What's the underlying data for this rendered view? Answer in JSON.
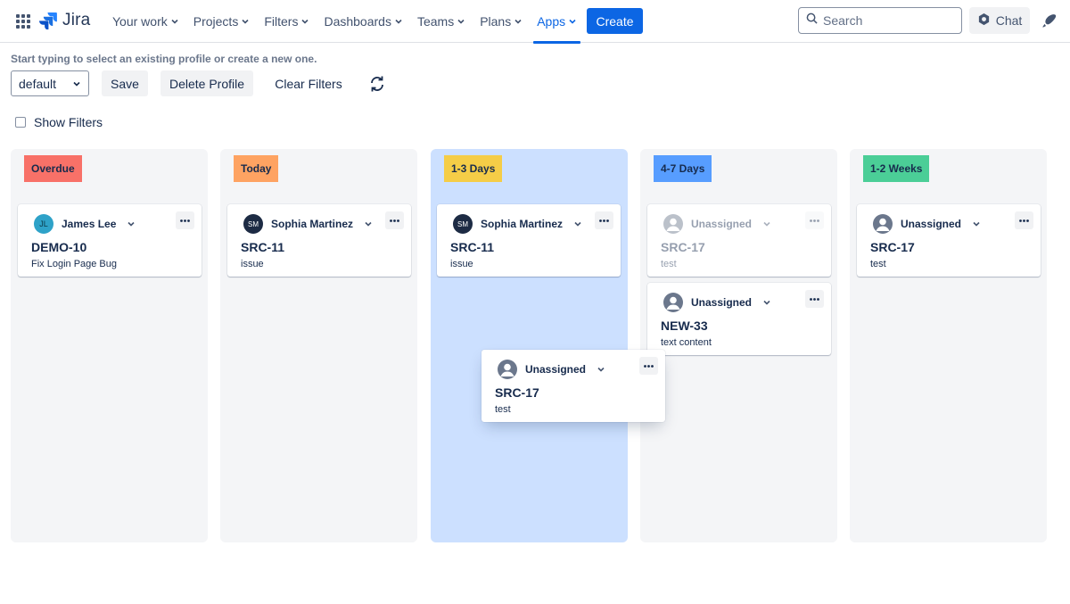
{
  "nav": {
    "app_name": "Jira",
    "items": [
      {
        "label": "Your work",
        "active": false
      },
      {
        "label": "Projects",
        "active": false
      },
      {
        "label": "Filters",
        "active": false
      },
      {
        "label": "Dashboards",
        "active": false
      },
      {
        "label": "Teams",
        "active": false
      },
      {
        "label": "Plans",
        "active": false
      },
      {
        "label": "Apps",
        "active": true
      }
    ],
    "create_label": "Create",
    "search_placeholder": "Search",
    "chat_label": "Chat",
    "accent_color": "#0c66e4"
  },
  "toolbar": {
    "hint": "Start typing to select an existing profile or create a new one.",
    "profile_value": "default",
    "save_label": "Save",
    "delete_label": "Delete Profile",
    "clear_label": "Clear Filters",
    "show_filters_label": "Show Filters",
    "show_filters_checked": false
  },
  "columns": [
    {
      "label": "Overdue",
      "color": "#f87168",
      "highlighted": false
    },
    {
      "label": "Today",
      "color": "#fea362",
      "highlighted": false
    },
    {
      "label": "1-3 Days",
      "color": "#f5cd47",
      "highlighted": true
    },
    {
      "label": "4-7 Days",
      "color": "#579dff",
      "highlighted": false
    },
    {
      "label": "1-2 Weeks",
      "color": "#4bce97",
      "highlighted": false
    }
  ],
  "cards": [
    {
      "column": 0,
      "assignee": "James Lee",
      "initials": "JL",
      "key": "DEMO-10",
      "summary": "Fix Login Page Bug",
      "state": "normal"
    },
    {
      "column": 1,
      "assignee": "Sophia Martinez",
      "initials": "SM",
      "key": "SRC-11",
      "summary": "issue",
      "state": "normal"
    },
    {
      "column": 2,
      "assignee": "Sophia Martinez",
      "initials": "SM",
      "key": "SRC-11",
      "summary": "issue",
      "state": "normal"
    },
    {
      "column": 3,
      "assignee": "Unassigned",
      "initials": "",
      "key": "SRC-17",
      "summary": "test",
      "state": "placeholder"
    },
    {
      "column": 3,
      "assignee": "Unassigned",
      "initials": "",
      "key": "NEW-33",
      "summary": "text content",
      "state": "normal"
    },
    {
      "column": 4,
      "assignee": "Unassigned",
      "initials": "",
      "key": "SRC-17",
      "summary": "test",
      "state": "normal"
    },
    {
      "column": 2,
      "assignee": "Unassigned",
      "initials": "",
      "key": "SRC-17",
      "summary": "test",
      "state": "dragging"
    }
  ]
}
